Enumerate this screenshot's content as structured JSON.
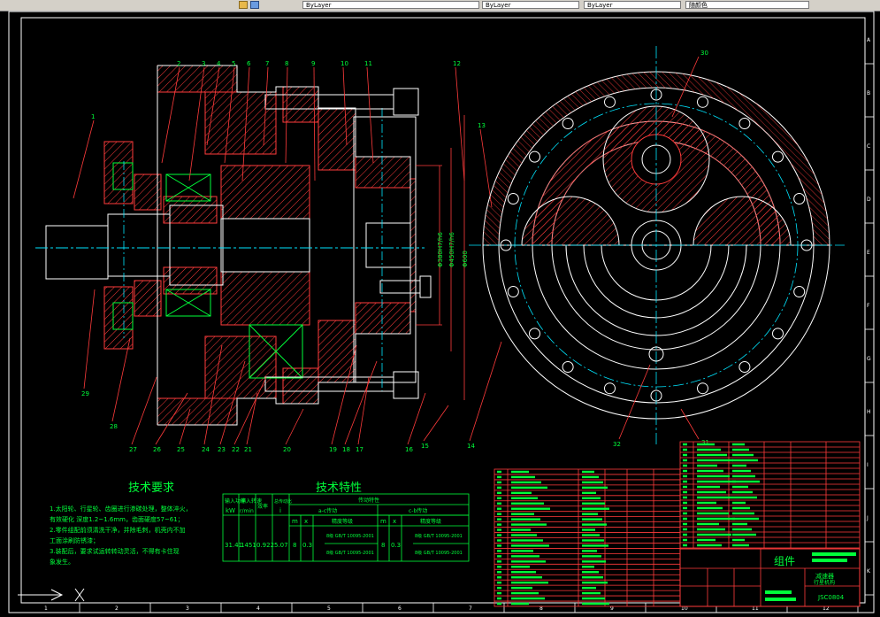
{
  "toolbar": {
    "field1": "ByLayer",
    "field2": "ByLayer",
    "field3": "ByLayer",
    "field4": "随颜色"
  },
  "drawing": {
    "tech_requirements_title": "技术要求",
    "tech_requirements_lines": [
      "1.太阳轮、行星轮、齿圈进行渗碳处理，整体淬火，",
      "有效硬化  深度1.2~1.6mm，齿面硬度57~61；",
      "2.零件组配前须清洗干净，并除毛刺，机壳内不加",
      "工面涂刷防锈漆；",
      "3.装配后，要求试运转转动灵活，不得有卡住现",
      "象发生。"
    ],
    "tech_specs_title": "技术特性",
    "spec_headers": {
      "input_power": "输入功率",
      "input_power_unit": "kW",
      "input_speed": "输入转速",
      "input_speed_unit": "r/min",
      "efficiency": "效率",
      "ratio": "总传动比",
      "ratio_sym": "i",
      "transmission": "传动特性",
      "ac_stage": "a-c传动",
      "cb_stage": "c-b传动",
      "module": "m",
      "teeth_x": "x",
      "precision": "精度等级"
    },
    "spec_values": {
      "power": "31.41",
      "speed": "1451",
      "eff": "0.922",
      "ratio": "5.07",
      "ac_m": "8",
      "ac_x": "0.3",
      "cb_m": "8",
      "cb_x": "0.3",
      "ac_prec1": "8级 GB/T 10095-2001",
      "ac_prec2": "8级 GB/T 10095-2001",
      "cb_prec1": "8级 GB/T 10095-2001",
      "cb_prec2": "8级 GB/T 10095-2001"
    },
    "title_block": {
      "assembly_label": "组件",
      "name_line1": "减速器",
      "name_line2": "行星机构",
      "drawing_no": "JSC0804"
    },
    "part_numbers_top": [
      "1",
      "2",
      "3",
      "4",
      "5",
      "6",
      "7",
      "8",
      "9",
      "10",
      "11",
      "12",
      "13"
    ],
    "part_numbers_bottom": [
      "29",
      "28",
      "27",
      "26",
      "25",
      "24",
      "23",
      "22",
      "21",
      "20",
      "19",
      "18",
      "17",
      "16",
      "15",
      "14"
    ],
    "part_numbers_right": [
      "30",
      "31",
      "32"
    ],
    "dim_labels": [
      "Φ600",
      "Φ450H7/h6",
      "Φ380H7/h6"
    ],
    "grid_letters": [
      "A",
      "B",
      "C",
      "D",
      "E",
      "F",
      "G",
      "H",
      "I",
      "J",
      "K"
    ],
    "grid_numbers": [
      "1",
      "2",
      "3",
      "4",
      "5",
      "6",
      "7",
      "8",
      "9",
      "10",
      "11",
      "12"
    ],
    "ucs_label": "X",
    "colors": {
      "background": "#000000",
      "border": "#ffffff",
      "part_lines": "#ff3b3b",
      "hatch": "#ff3b3b",
      "centerline": "#00e5ff",
      "text": "#00ff3a",
      "title_block": "#ff3b3b",
      "mask_fill": "#00ff3a"
    }
  }
}
